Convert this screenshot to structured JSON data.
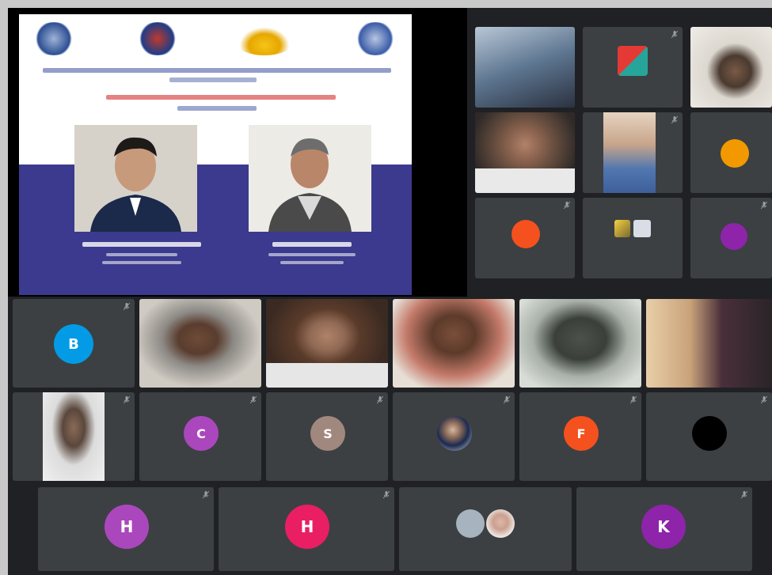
{
  "presentation": {
    "header_line": "",
    "title_line": "",
    "speakers": [
      {
        "name": "",
        "caption": ""
      },
      {
        "name": "",
        "caption": ""
      }
    ]
  },
  "participants_top": [
    {
      "name": "",
      "avatar": "",
      "avatar_color": ""
    },
    {
      "name": "",
      "avatar": "",
      "avatar_color": ""
    },
    {
      "name": "",
      "avatar": "",
      "avatar_color": ""
    },
    {
      "name": "",
      "avatar": "",
      "avatar_color": ""
    },
    {
      "name": "",
      "avatar": "",
      "avatar_color": ""
    },
    {
      "name": "",
      "avatar": "",
      "avatar_color": "#f29900"
    },
    {
      "name": "",
      "avatar": "",
      "avatar_color": "#f4511e"
    },
    {
      "name": "",
      "avatar": "",
      "avatar_color": ""
    },
    {
      "name": "",
      "avatar": "",
      "avatar_color": "#8e24aa"
    }
  ],
  "participants_row1": [
    {
      "name": "",
      "avatar": "B",
      "avatar_color": "#039be5"
    },
    {
      "name": "",
      "avatar": "",
      "avatar_color": ""
    },
    {
      "name": "",
      "avatar": "",
      "avatar_color": ""
    },
    {
      "name": "",
      "avatar": "",
      "avatar_color": ""
    },
    {
      "name": "",
      "avatar": "",
      "avatar_color": ""
    },
    {
      "name": "",
      "avatar": "",
      "avatar_color": ""
    }
  ],
  "participants_row2": [
    {
      "name": "",
      "avatar": "",
      "avatar_color": ""
    },
    {
      "name": "",
      "avatar": "C",
      "avatar_color": "#ab47bc"
    },
    {
      "name": "",
      "avatar": "S",
      "avatar_color": "#a1887f"
    },
    {
      "name": "",
      "avatar": "",
      "avatar_color": ""
    },
    {
      "name": "",
      "avatar": "F",
      "avatar_color": "#f4511e"
    },
    {
      "name": "",
      "avatar": "",
      "avatar_color": "#000000"
    }
  ],
  "participants_row3": [
    {
      "name": "",
      "avatar": "H",
      "avatar_color": "#ab47bc"
    },
    {
      "name": "",
      "avatar": "H",
      "avatar_color": "#e91e63"
    },
    {
      "name": "",
      "avatar": "",
      "avatar_color": ""
    },
    {
      "name": "",
      "avatar": "K",
      "avatar_color": "#8e24aa"
    }
  ],
  "icons": {
    "mic": "mic-off-icon",
    "presentation_logos": [
      "emblem-logo",
      "emblem-logo",
      "emblem-logo",
      "emblem-logo"
    ]
  }
}
